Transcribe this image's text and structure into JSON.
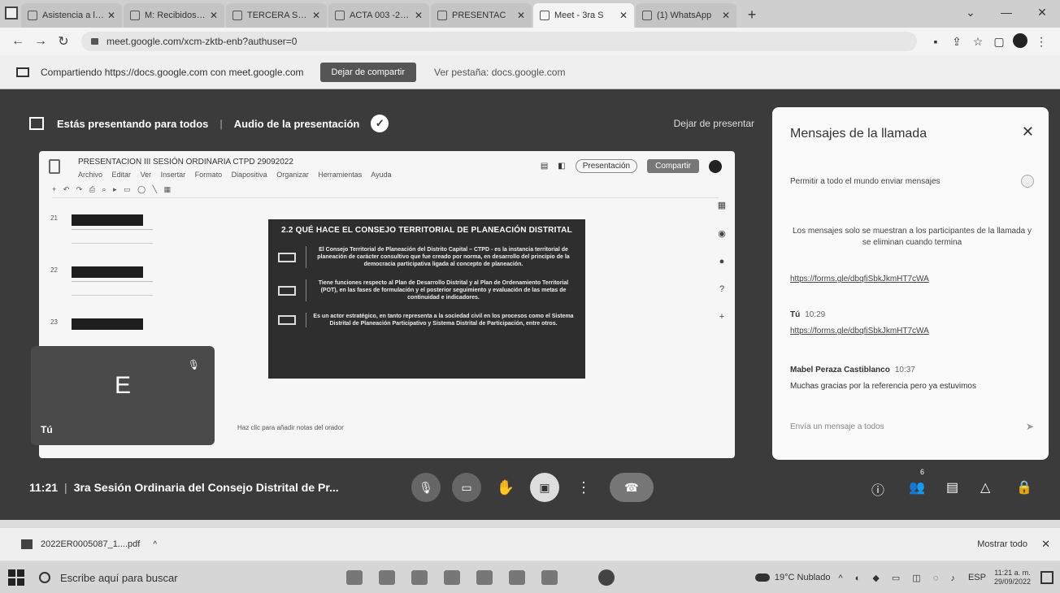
{
  "browser": {
    "tabs": [
      {
        "label": "Asistencia a la s",
        "active": false
      },
      {
        "label": "M: Recibidos (22)",
        "active": false
      },
      {
        "label": "TERCERA SESIÓ",
        "active": false
      },
      {
        "label": "ACTA 003 -2022",
        "active": false
      },
      {
        "label": "PRESENTAC",
        "active": false
      },
      {
        "label": "Meet - 3ra S",
        "active": true
      },
      {
        "label": "(1) WhatsApp",
        "active": false
      }
    ],
    "url": "meet.google.com/xcm-zktb-enb?authuser=0",
    "window_controls": [
      "⌄",
      "—",
      "✕"
    ]
  },
  "share_banner": {
    "text": "Compartiendo https://docs.google.com con meet.google.com",
    "stop_button": "Dejar de compartir",
    "view_tab": "Ver pestaña: docs.google.com"
  },
  "meet": {
    "presenting_text": "Estás presentando para todos",
    "audio_label": "Audio de la presentación",
    "stop_presenting": "Dejar de presentar",
    "slides": {
      "doc_title": "PRESENTACION III SESIÓN ORDINARIA CTPD  29092022",
      "menu": [
        "Archivo",
        "Editar",
        "Ver",
        "Insertar",
        "Formato",
        "Diapositiva",
        "Organizar",
        "Herramientas",
        "Ayuda"
      ],
      "slideshow_label": "Presentación",
      "share_label": "Compartir",
      "thumb_numbers": [
        "21",
        "22",
        "23"
      ],
      "slide_heading": "2.2 QUÉ HACE EL CONSEJO TERRITORIAL DE PLANEACIÓN DISTRITAL",
      "slide_points": [
        "El Consejo Territorial de Planeación del Distrito Capital – CTPD - es la instancia territorial de planeación de carácter consultivo que fue creado por norma, en desarrollo del principio de la democracia participativa ligada al concepto de planeación.",
        "Tiene funciones respecto al Plan de Desarrollo Distrital y al Plan de Ordenamiento Territorial (POT), en las fases de formulación y el posterior seguimiento y evaluación de las metas de continuidad e indicadores.",
        "Es un actor estratégico, en tanto representa a la sociedad civil en los procesos como el  Sistema Distrital de Planeación Participativo y Sistema Distrital de Participación, entre otros."
      ],
      "notes_hint": "Haz clic para añadir notas del orador"
    },
    "self_tile": {
      "initial": "E",
      "label": "Tú"
    },
    "chat": {
      "title": "Mensajes de la llamada",
      "allow_label": "Permitir a todo el mundo enviar mensajes",
      "info": "Los mensajes solo se muestran a los participantes de la llamada y se eliminan cuando termina",
      "link1": "https://forms.gle/dbqfiSbkJkmHT7cWA",
      "msg1_author": "Tú",
      "msg1_time": "10:29",
      "msg1_link": "https://forms.gle/dbqfiSbkJkmHT7cWA",
      "msg2_author": "Mabel Peraza Castiblanco",
      "msg2_time": "10:37",
      "msg2_text": "Muchas gracias por la referencia pero ya estuvimos",
      "input_placeholder": "Envía un mensaje a todos"
    },
    "meeting_time": "11:21",
    "meeting_title": "3ra Sesión Ordinaria del Consejo Distrital de Pr...",
    "participants_badge": "6"
  },
  "downloads": {
    "file": "2022ER0005087_1....pdf",
    "show_all": "Mostrar todo"
  },
  "taskbar": {
    "search_placeholder": "Escribe aquí para buscar",
    "weather": "19°C  Nublado",
    "lang": "ESP",
    "time": "11:21 a. m.",
    "date": "29/09/2022"
  }
}
